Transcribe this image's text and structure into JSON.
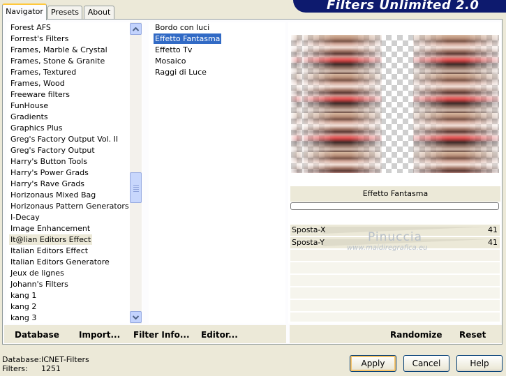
{
  "tabs": [
    "Navigator",
    "Presets",
    "About"
  ],
  "banner_title": "Filters Unlimited 2.0",
  "categories": [
    "Forest AFS",
    "Forrest's Filters",
    "Frames, Marble & Crystal",
    "Frames, Stone & Granite",
    "Frames, Textured",
    "Frames, Wood",
    "Freeware filters",
    "FunHouse",
    "Gradients",
    "Graphics Plus",
    "Greg's Factory Output Vol. II",
    "Greg's Factory Output",
    "Harry's Button Tools",
    "Harry's Power Grads",
    "Harry's Rave Grads",
    "Horizonaus Mixed Bag",
    "Horizonaus Pattern Generators",
    "I-Decay",
    "Image Enhancement",
    "It@lian Editors Effect",
    "Italian Editors Effect",
    "Italian Editors Generatore",
    "Jeux de lignes",
    "Johann's Filters",
    "kang 1",
    "kang 2",
    "kang 3"
  ],
  "selected_category": "It@lian Editors Effect",
  "effects": [
    "Bordo con luci",
    "Effetto Fantasma",
    "Effetto Tv",
    "Mosaico",
    "Raggi di Luce"
  ],
  "selected_effect": "Effetto Fantasma",
  "effect_name": "Effetto Fantasma",
  "params": [
    {
      "label": "Sposta-X",
      "value": "41"
    },
    {
      "label": "Sposta-Y",
      "value": "41"
    }
  ],
  "watermark": {
    "line1": "Pinuccia",
    "line2": "www.maidiregrafica.eu"
  },
  "left_toolbar": {
    "database": "Database",
    "import": "Import...",
    "filter_info": "Filter Info...",
    "editor": "Editor..."
  },
  "right_toolbar": {
    "randomize": "Randomize",
    "reset": "Reset"
  },
  "footer": {
    "database_label": "Database:",
    "database_value": "ICNET-Filters",
    "filters_label": "Filters:",
    "filters_value": "1251"
  },
  "buttons": {
    "apply": "Apply",
    "cancel": "Cancel",
    "help": "Help"
  },
  "icons": {
    "scroll_up": "chevron-up-icon",
    "scroll_down": "chevron-down-icon"
  }
}
